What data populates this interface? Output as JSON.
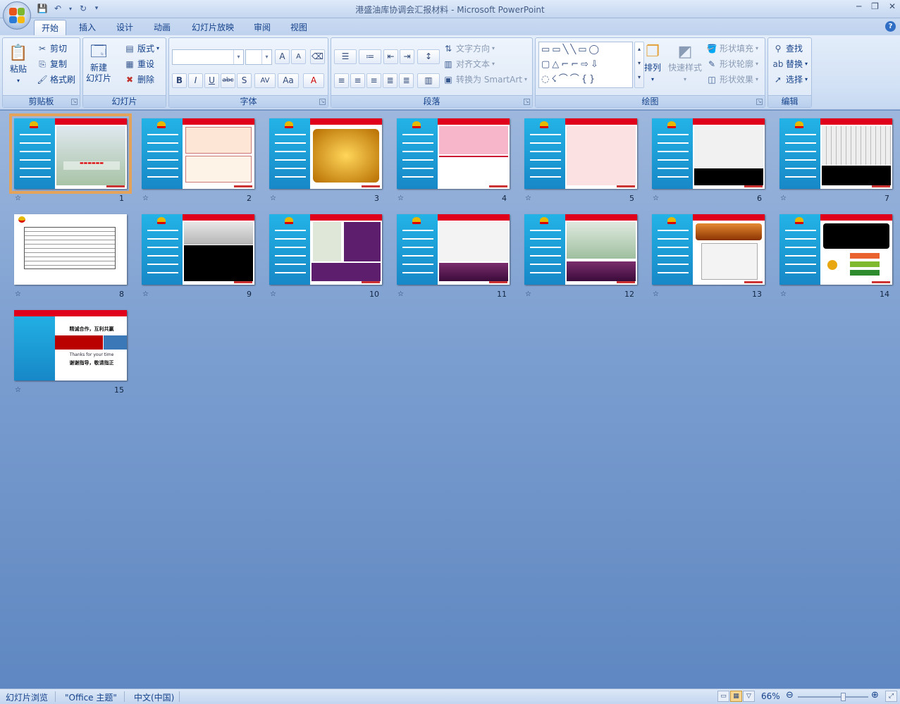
{
  "window": {
    "title": "港盛油库协调会汇报材料 - Microsoft PowerPoint",
    "controls": [
      "─",
      "❐",
      "✕"
    ]
  },
  "tabs": [
    "开始",
    "插入",
    "设计",
    "动画",
    "幻灯片放映",
    "审阅",
    "视图"
  ],
  "active_tab": "开始",
  "ribbon": {
    "clipboard": {
      "label": "剪贴板",
      "paste": "粘贴",
      "cut": "剪切",
      "copy": "复制",
      "format_painter": "格式刷"
    },
    "slides": {
      "label": "幻灯片",
      "new_slide": "新建\n幻灯片",
      "layout": "版式",
      "reset": "重设",
      "delete": "删除"
    },
    "font": {
      "label": "字体",
      "bold": "B",
      "italic": "I",
      "underline": "U",
      "strike": "abc",
      "shadow": "S",
      "spacing": "AV",
      "case": "Aa",
      "color": "A",
      "grow": "A",
      "shrink": "A"
    },
    "paragraph": {
      "label": "段落",
      "text_direction": "文字方向",
      "align_text": "对齐文本",
      "convert_smartart": "转换为 SmartArt"
    },
    "drawing": {
      "label": "绘图",
      "arrange": "排列",
      "quick_styles": "快速样式",
      "shape_fill": "形状填充",
      "shape_outline": "形状轮廓",
      "shape_effects": "形状效果"
    },
    "editing": {
      "label": "编辑",
      "find": "查找",
      "replace": "替换",
      "select": "选择"
    }
  },
  "slides": [
    {
      "num": "1",
      "selected": true
    },
    {
      "num": "2"
    },
    {
      "num": "3"
    },
    {
      "num": "4"
    },
    {
      "num": "5"
    },
    {
      "num": "6"
    },
    {
      "num": "7"
    },
    {
      "num": "8"
    },
    {
      "num": "9"
    },
    {
      "num": "10"
    },
    {
      "num": "11"
    },
    {
      "num": "12"
    },
    {
      "num": "13"
    },
    {
      "num": "14"
    },
    {
      "num": "15"
    }
  ],
  "slide15": {
    "line1": "精诚合作，互利共赢",
    "line2": "Thanks for your time",
    "line3": "谢谢指导，敬请指正"
  },
  "status": {
    "view": "幻灯片浏览",
    "theme": "\"Office 主题\"",
    "language": "中文(中国)",
    "zoom": "66%"
  },
  "colors": {
    "accent_red": "#e0001b",
    "slide_blue": "#1f9fdc",
    "selection": "#e3a35a"
  },
  "zoom_fraction": 0.66
}
